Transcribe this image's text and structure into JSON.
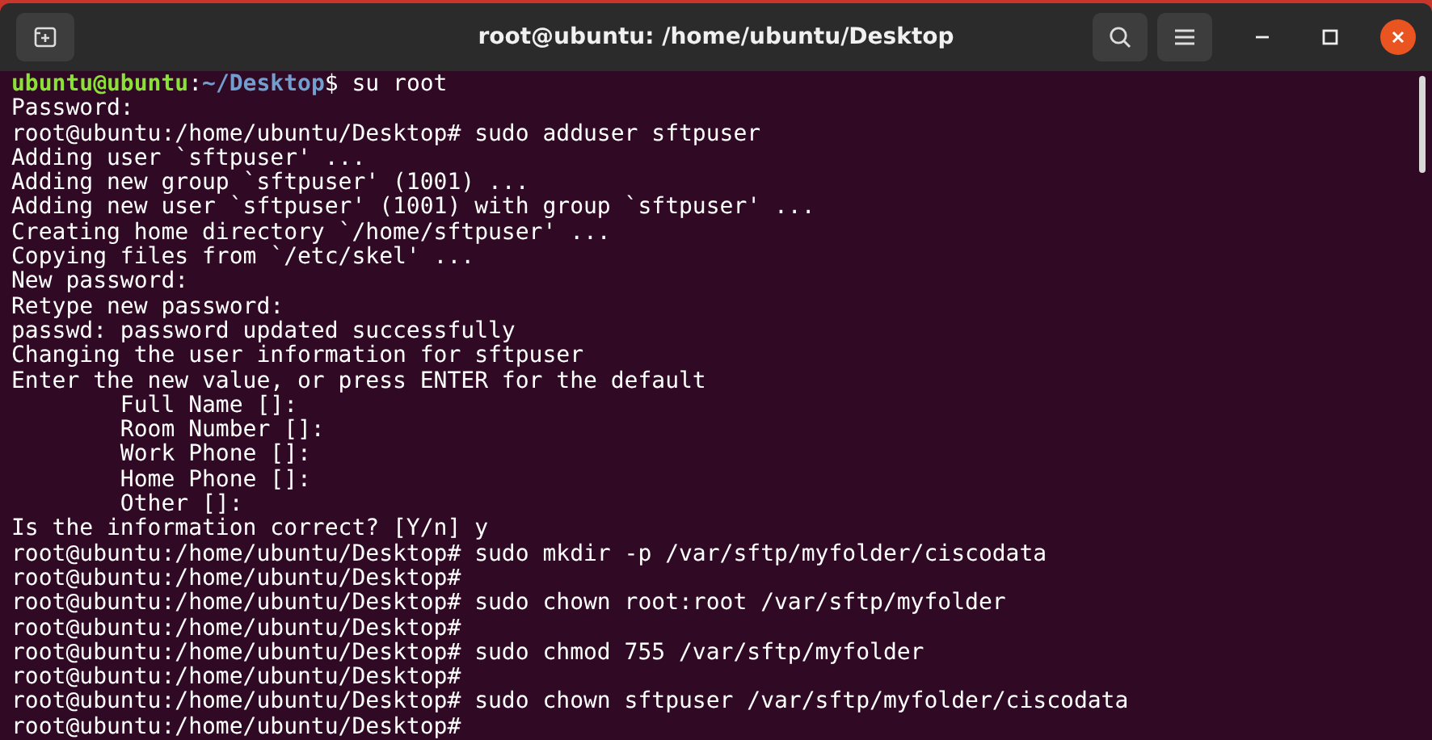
{
  "window": {
    "title": "root@ubuntu: /home/ubuntu/Desktop"
  },
  "terminal": {
    "lines": [
      [
        {
          "kind": "user",
          "text": "ubuntu@ubuntu"
        },
        {
          "kind": "plain",
          "text": ":"
        },
        {
          "kind": "path",
          "text": "~/Desktop"
        },
        {
          "kind": "plain",
          "text": "$ su root"
        }
      ],
      [
        {
          "kind": "plain",
          "text": "Password:"
        }
      ],
      [
        {
          "kind": "plain",
          "text": "root@ubuntu:/home/ubuntu/Desktop# sudo adduser sftpuser"
        }
      ],
      [
        {
          "kind": "plain",
          "text": "Adding user `sftpuser' ..."
        }
      ],
      [
        {
          "kind": "plain",
          "text": "Adding new group `sftpuser' (1001) ..."
        }
      ],
      [
        {
          "kind": "plain",
          "text": "Adding new user `sftpuser' (1001) with group `sftpuser' ..."
        }
      ],
      [
        {
          "kind": "plain",
          "text": "Creating home directory `/home/sftpuser' ..."
        }
      ],
      [
        {
          "kind": "plain",
          "text": "Copying files from `/etc/skel' ..."
        }
      ],
      [
        {
          "kind": "plain",
          "text": "New password:"
        }
      ],
      [
        {
          "kind": "plain",
          "text": "Retype new password:"
        }
      ],
      [
        {
          "kind": "plain",
          "text": "passwd: password updated successfully"
        }
      ],
      [
        {
          "kind": "plain",
          "text": "Changing the user information for sftpuser"
        }
      ],
      [
        {
          "kind": "plain",
          "text": "Enter the new value, or press ENTER for the default"
        }
      ],
      [
        {
          "kind": "plain",
          "text": "        Full Name []:"
        }
      ],
      [
        {
          "kind": "plain",
          "text": "        Room Number []:"
        }
      ],
      [
        {
          "kind": "plain",
          "text": "        Work Phone []:"
        }
      ],
      [
        {
          "kind": "plain",
          "text": "        Home Phone []:"
        }
      ],
      [
        {
          "kind": "plain",
          "text": "        Other []:"
        }
      ],
      [
        {
          "kind": "plain",
          "text": "Is the information correct? [Y/n] y"
        }
      ],
      [
        {
          "kind": "plain",
          "text": "root@ubuntu:/home/ubuntu/Desktop# sudo mkdir -p /var/sftp/myfolder/ciscodata"
        }
      ],
      [
        {
          "kind": "plain",
          "text": "root@ubuntu:/home/ubuntu/Desktop#"
        }
      ],
      [
        {
          "kind": "plain",
          "text": "root@ubuntu:/home/ubuntu/Desktop# sudo chown root:root /var/sftp/myfolder"
        }
      ],
      [
        {
          "kind": "plain",
          "text": "root@ubuntu:/home/ubuntu/Desktop#"
        }
      ],
      [
        {
          "kind": "plain",
          "text": "root@ubuntu:/home/ubuntu/Desktop# sudo chmod 755 /var/sftp/myfolder"
        }
      ],
      [
        {
          "kind": "plain",
          "text": "root@ubuntu:/home/ubuntu/Desktop#"
        }
      ],
      [
        {
          "kind": "plain",
          "text": "root@ubuntu:/home/ubuntu/Desktop# sudo chown sftpuser /var/sftp/myfolder/ciscodata"
        }
      ],
      [
        {
          "kind": "plain",
          "text": "root@ubuntu:/home/ubuntu/Desktop#"
        }
      ]
    ]
  }
}
